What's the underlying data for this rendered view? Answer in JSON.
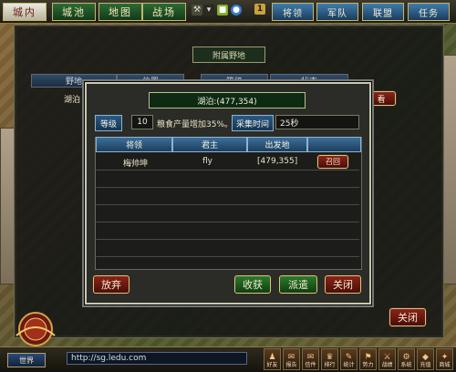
{
  "topnav": {
    "tabs": [
      {
        "label": "城内",
        "active": true
      },
      {
        "label": "城池",
        "active": false
      },
      {
        "label": "地图",
        "active": false
      },
      {
        "label": "战场",
        "active": false
      }
    ],
    "notify_count": "1",
    "right_buttons": [
      "将领",
      "军队",
      "联盟",
      "任务"
    ]
  },
  "background_panel": {
    "title": "附属野地",
    "columns": [
      "野地",
      "位置",
      "等级",
      "状态"
    ],
    "first_row_label": "湖泊",
    "close_label": "关闭"
  },
  "dialog": {
    "title": "湖泊:(477,354)",
    "level_label": "等级",
    "level_value": "10",
    "bonus_text": "粮食产量增加35%。",
    "collect_time_label": "采集时间",
    "collect_time_value": "25秒",
    "table": {
      "headers": [
        "将领",
        "君主",
        "出发地",
        ""
      ],
      "rows": [
        {
          "general": "梅帅坤",
          "lord": "fly",
          "origin": "[479,355]",
          "action": "召回"
        }
      ]
    },
    "buttons": {
      "abandon": "放弃",
      "harvest": "收获",
      "dispatch": "派遣",
      "close": "关闭"
    }
  },
  "bottombar": {
    "world_label": "世界",
    "url": "http://sg.ledu.com",
    "icons": [
      {
        "label": "好友",
        "icon": "friends-icon"
      },
      {
        "label": "报告",
        "icon": "report-icon"
      },
      {
        "label": "信件",
        "icon": "mail-icon"
      },
      {
        "label": "排行",
        "icon": "ranking-icon"
      },
      {
        "label": "统计",
        "icon": "stats-icon"
      },
      {
        "label": "势力",
        "icon": "power-icon"
      },
      {
        "label": "战绩",
        "icon": "battle-icon"
      },
      {
        "label": "系统",
        "icon": "system-icon"
      },
      {
        "label": "充值",
        "icon": "recharge-icon"
      },
      {
        "label": "商城",
        "icon": "shop-icon"
      }
    ]
  },
  "colors": {
    "nav_green": "#2d6a36",
    "nav_blue": "#3f7cab",
    "button_red": "#8a2418",
    "button_green": "#2c7a2c",
    "label_blue": "#2a5a84"
  }
}
